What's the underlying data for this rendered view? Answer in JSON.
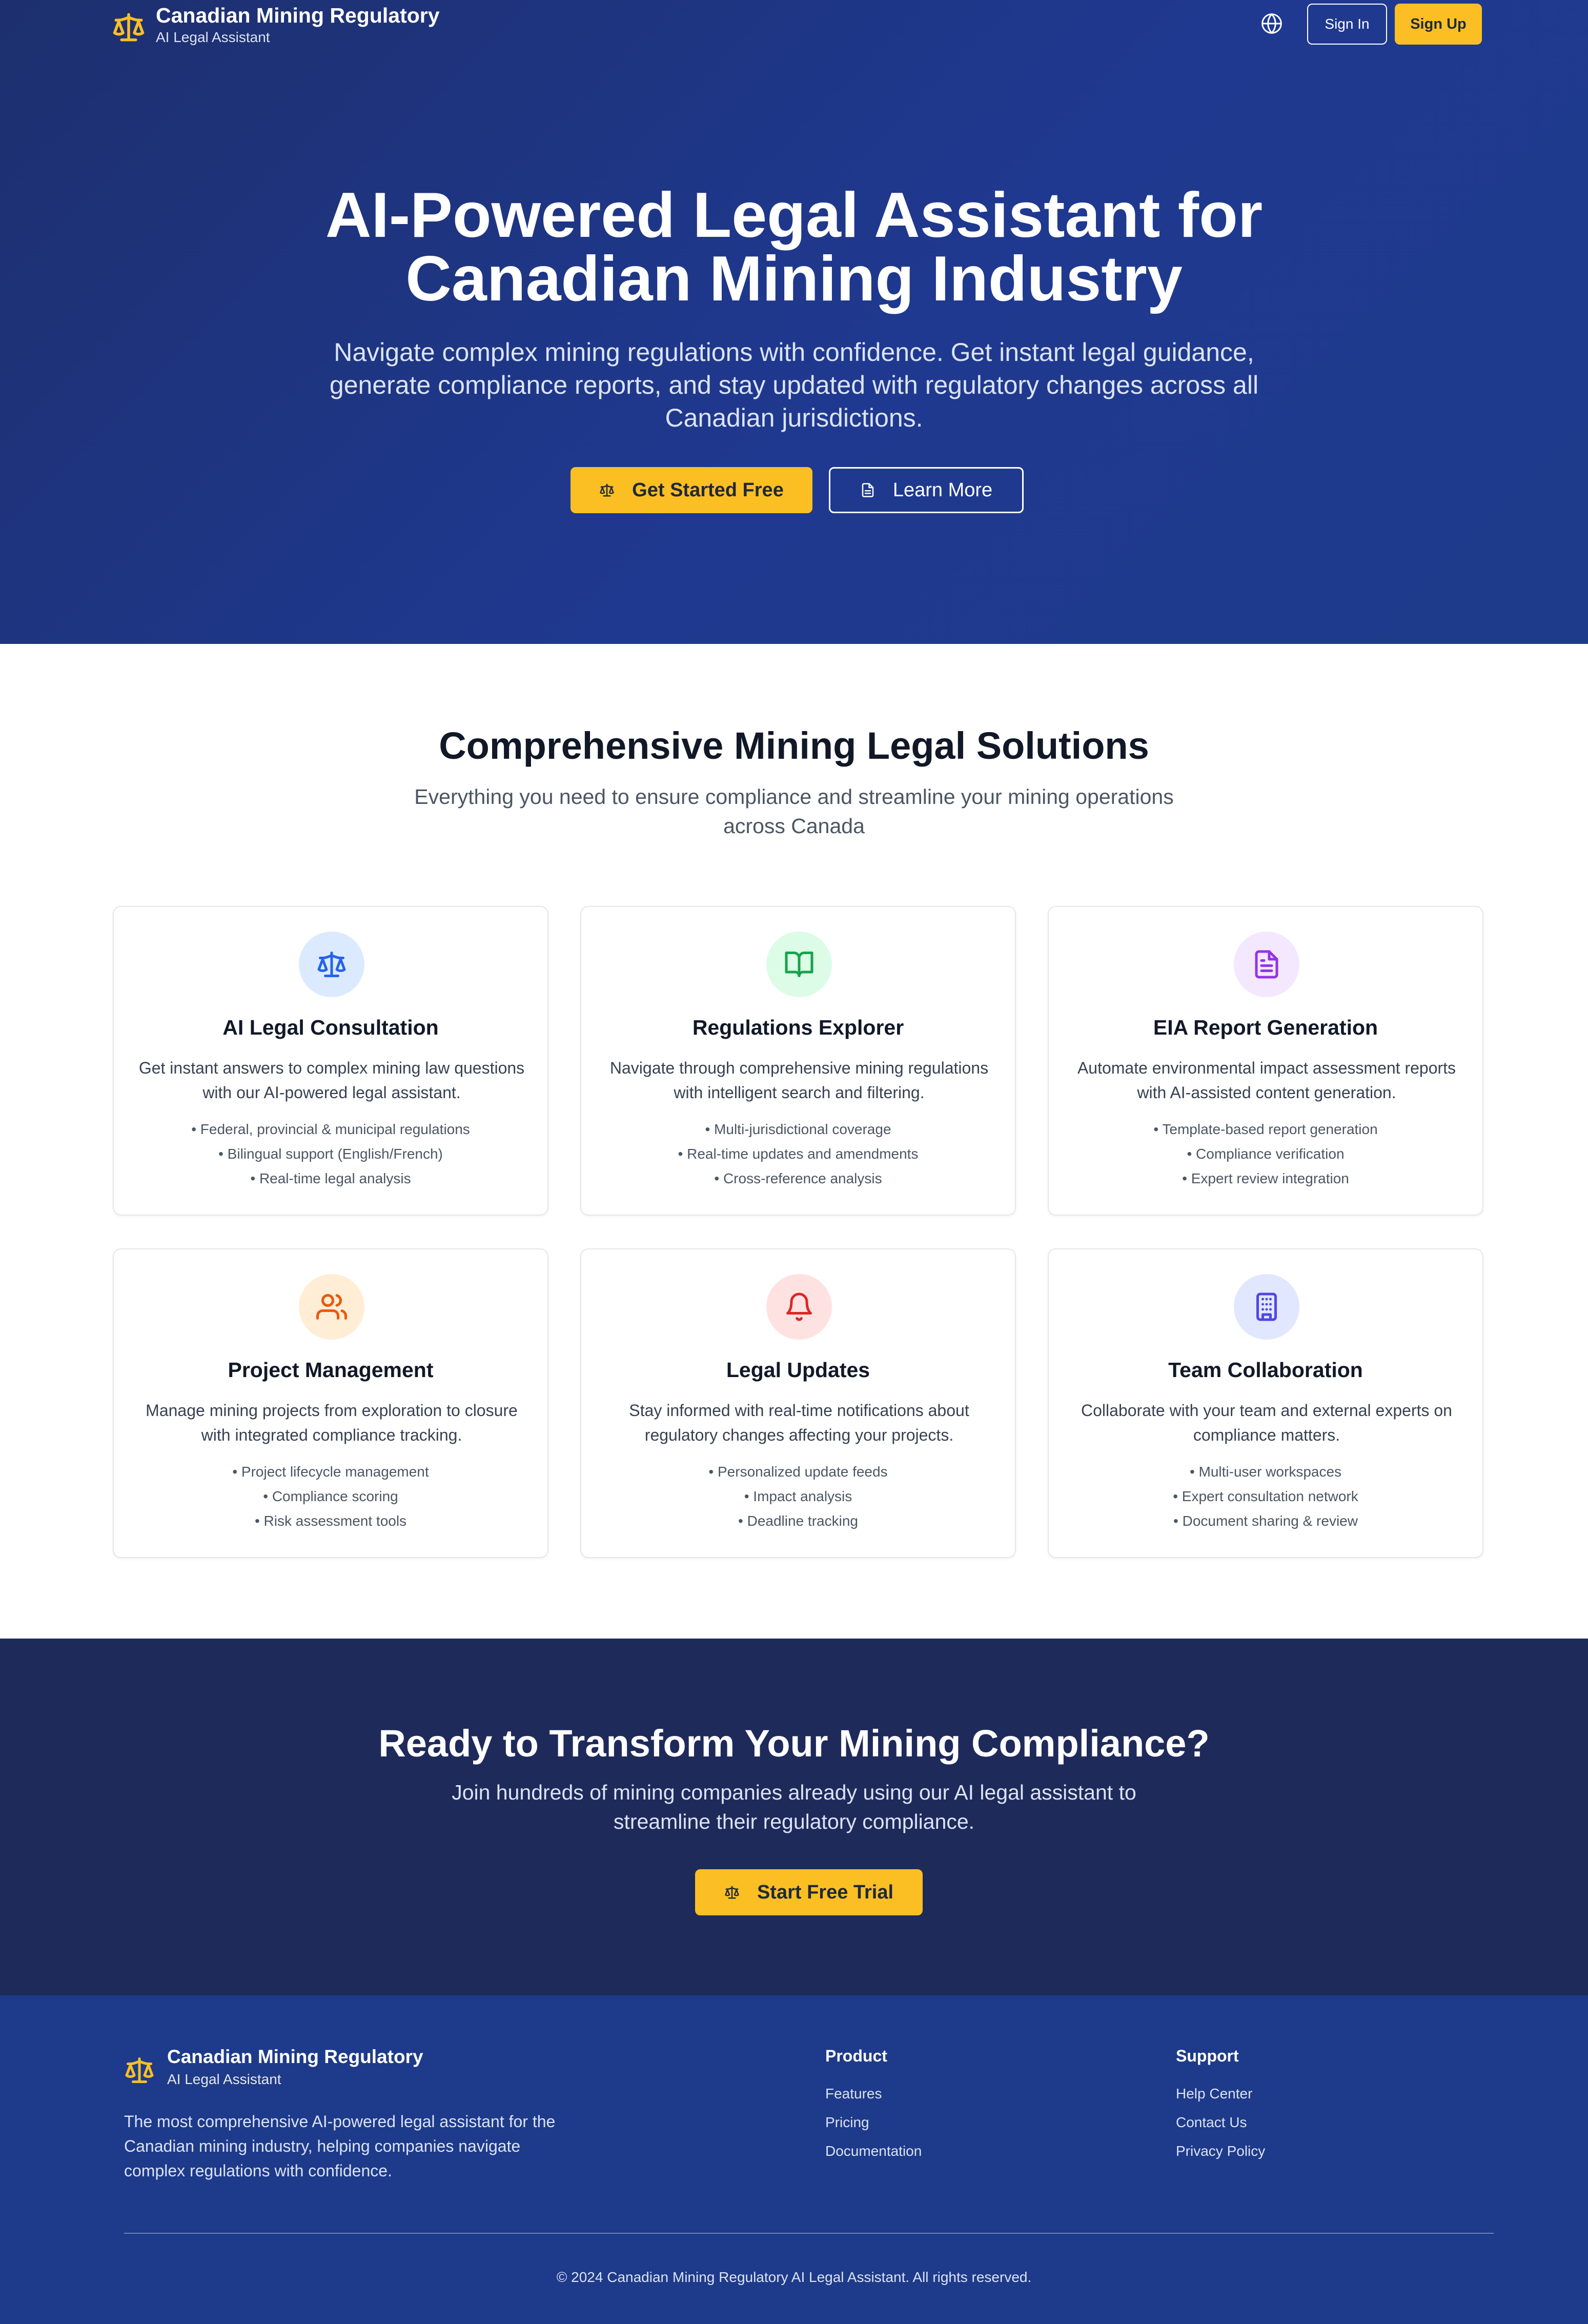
{
  "brand": {
    "name": "Canadian Mining Regulatory",
    "tagline": "AI Legal Assistant",
    "accent": "#fbbf24",
    "primary": "#1e3a8a"
  },
  "nav": {
    "language_icon": "globe-icon",
    "signin": "Sign In",
    "signup": "Sign Up"
  },
  "hero": {
    "title_line1": "AI-Powered Legal Assistant for",
    "title_line2": "Canadian Mining Industry",
    "subtitle": "Navigate complex mining regulations with confidence. Get instant legal guidance, generate compliance reports, and stay updated with regulatory changes across all Canadian jurisdictions.",
    "primary_cta": "Get Started Free",
    "secondary_cta": "Learn More"
  },
  "features": {
    "title": "Comprehensive Mining Legal Solutions",
    "subtitle": "Everything you need to ensure compliance and streamline your mining operations across Canada",
    "cards": [
      {
        "icon": "scale-icon",
        "title": "AI Legal Consultation",
        "description": "Get instant answers to complex mining law questions with our AI-powered legal assistant.",
        "bullets": [
          "• Federal, provincial & municipal regulations",
          "• Bilingual support (English/French)",
          "• Real-time legal analysis"
        ]
      },
      {
        "icon": "book-open-icon",
        "title": "Regulations Explorer",
        "description": "Navigate through comprehensive mining regulations with intelligent search and filtering.",
        "bullets": [
          "• Multi-jurisdictional coverage",
          "• Real-time updates and amendments",
          "• Cross-reference analysis"
        ]
      },
      {
        "icon": "file-text-icon",
        "title": "EIA Report Generation",
        "description": "Automate environmental impact assessment reports with AI-assisted content generation.",
        "bullets": [
          "• Template-based report generation",
          "• Compliance verification",
          "• Expert review integration"
        ]
      },
      {
        "icon": "users-icon",
        "title": "Project Management",
        "description": "Manage mining projects from exploration to closure with integrated compliance tracking.",
        "bullets": [
          "• Project lifecycle management",
          "• Compliance scoring",
          "• Risk assessment tools"
        ]
      },
      {
        "icon": "bell-icon",
        "title": "Legal Updates",
        "description": "Stay informed with real-time notifications about regulatory changes affecting your projects.",
        "bullets": [
          "• Personalized update feeds",
          "• Impact analysis",
          "• Deadline tracking"
        ]
      },
      {
        "icon": "building-icon",
        "title": "Team Collaboration",
        "description": "Collaborate with your team and external experts on compliance matters.",
        "bullets": [
          "• Multi-user workspaces",
          "• Expert consultation network",
          "• Document sharing & review"
        ]
      }
    ]
  },
  "cta": {
    "title": "Ready to Transform Your Mining Compliance?",
    "subtitle": "Join hundreds of mining companies already using our AI legal assistant to streamline their regulatory compliance.",
    "button": "Start Free Trial"
  },
  "footer": {
    "name": "Canadian Mining Regulatory",
    "tagline": "AI Legal Assistant",
    "description": "The most comprehensive AI-powered legal assistant for the Canadian mining industry, helping companies navigate complex regulations with confidence.",
    "product": {
      "heading": "Product",
      "links": [
        "Features",
        "Pricing",
        "Documentation"
      ]
    },
    "support": {
      "heading": "Support",
      "links": [
        "Help Center",
        "Contact Us",
        "Privacy Policy"
      ]
    },
    "copyright": "© 2024 Canadian Mining Regulatory AI Legal Assistant. All rights reserved."
  }
}
